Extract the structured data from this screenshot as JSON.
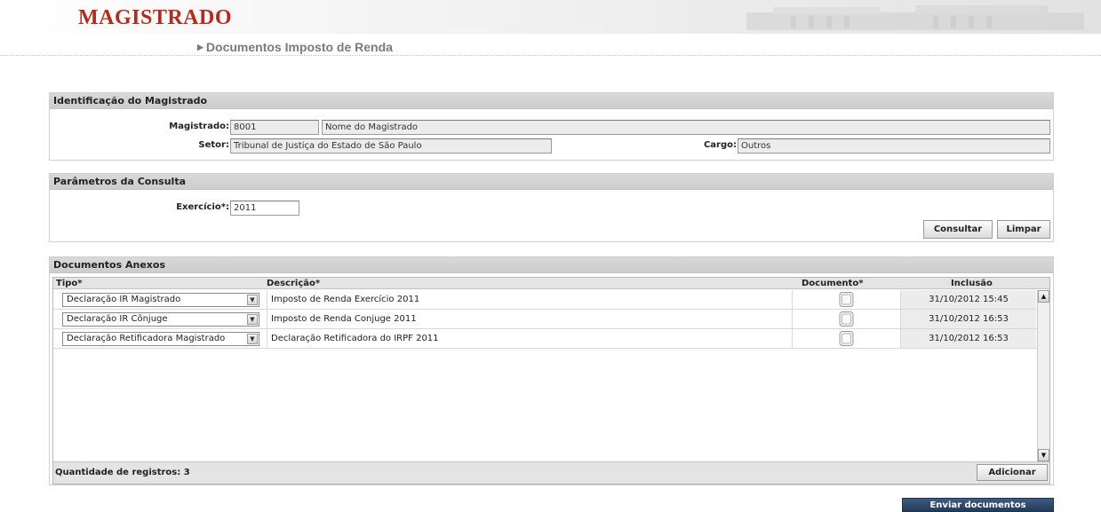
{
  "header": {
    "app_title": "MAGISTRADO",
    "page_heading": "Documentos Imposto de Renda"
  },
  "identificacao": {
    "title": "Identificação do Magistrado",
    "magistrado_label": "Magistrado:",
    "magistrado_code": "8001",
    "magistrado_name": "Nome do Magistrado",
    "setor_label": "Setor:",
    "setor_value": "Tribunal de Justiça do Estado de São Paulo",
    "cargo_label": "Cargo:",
    "cargo_value": "Outros"
  },
  "parametros": {
    "title": "Parâmetros da Consulta",
    "exercicio_label": "Exercício*:",
    "exercicio_value": "2011",
    "consultar_label": "Consultar",
    "limpar_label": "Limpar"
  },
  "documentos": {
    "title": "Documentos Anexos",
    "columns": {
      "tipo": "Tipo*",
      "descricao": "Descrição*",
      "documento": "Documento*",
      "inclusao": "Inclusão"
    },
    "rows": [
      {
        "tipo": "Declaração IR Magistrado",
        "descricao": "Imposto de Renda Exercício 2011",
        "inclusao": "31/10/2012 15:45"
      },
      {
        "tipo": "Declaração IR Cônjuge",
        "descricao": "Imposto de Renda Conjuge 2011",
        "inclusao": "31/10/2012 16:53"
      },
      {
        "tipo": "Declaração Retificadora Magistrado",
        "descricao": "Declaração Retificadora do IRPF 2011",
        "inclusao": "31/10/2012 16:53"
      }
    ],
    "count_label": "Quantidade de registros: 3",
    "adicionar_label": "Adicionar"
  },
  "enviar_label": "Enviar documentos",
  "colors": {
    "brand_red": "#b52a1c",
    "panel_header": "#d3d3d3",
    "button_dark": "#2f4a6e"
  },
  "icons": {
    "heading_arrow": "right-triangle-icon",
    "document": "document-icon",
    "dropdown": "chevron-down-icon"
  }
}
